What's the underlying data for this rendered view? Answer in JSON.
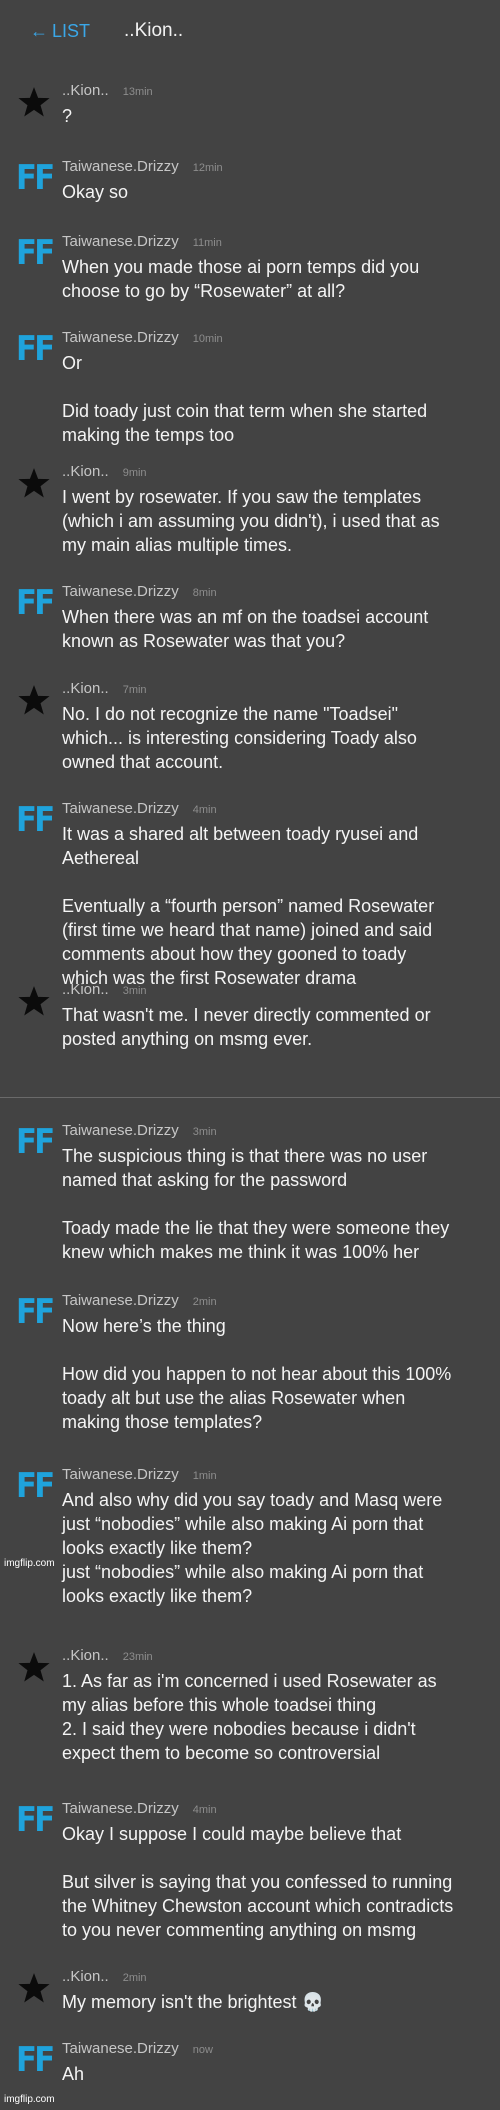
{
  "header": {
    "back_arrow": "←",
    "back_label": "LIST",
    "title": "..Kion.."
  },
  "messages": [
    {
      "avatar": "star",
      "user": "..Kion..",
      "time": "13min",
      "paragraphs": [
        "?"
      ]
    },
    {
      "avatar": "ff",
      "user": "Taiwanese.Drizzy",
      "time": "12min",
      "paragraphs": [
        "Okay so"
      ]
    },
    {
      "avatar": "ff",
      "user": "Taiwanese.Drizzy",
      "time": "11min",
      "paragraphs": [
        "When you made those ai porn temps did you\nchoose to go by “Rosewater” at all?"
      ]
    },
    {
      "avatar": "ff",
      "user": "Taiwanese.Drizzy",
      "time": "10min",
      "paragraphs": [
        "Or",
        "Did toady just coin that term when she started\nmaking the temps too"
      ]
    },
    {
      "avatar": "star",
      "user": "..Kion..",
      "time": "9min",
      "paragraphs": [
        "I went by rosewater. If you saw the templates\n(which i am assuming you didn't), i used that as\nmy main alias multiple times."
      ]
    },
    {
      "avatar": "ff",
      "user": "Taiwanese.Drizzy",
      "time": "8min",
      "paragraphs": [
        "When there was an mf on the toadsei account\nknown as Rosewater was that you?"
      ]
    },
    {
      "avatar": "star",
      "user": "..Kion..",
      "time": "7min",
      "paragraphs": [
        "No. I do not recognize the name \"Toadsei\"\nwhich... is interesting considering Toady also\nowned that account."
      ]
    },
    {
      "avatar": "ff",
      "user": "Taiwanese.Drizzy",
      "time": "4min",
      "paragraphs": [
        "It was a shared alt between toady ryusei and\nAethereal",
        "Eventually a “fourth person” named Rosewater\n(first time we heard that name) joined and said\ncomments about how they gooned to toady\nwhich was the first Rosewater drama"
      ]
    },
    {
      "avatar": "star",
      "user": "..Kion..",
      "time": "3min",
      "paragraphs": [
        "That wasn't me. I never directly commented or\nposted anything on msmg ever."
      ]
    },
    {
      "avatar": "ff",
      "user": "Taiwanese.Drizzy",
      "time": "3min",
      "paragraphs": [
        "The suspicious thing is that there was no user\nnamed that asking for the password",
        "Toady made the lie that they were someone they\nknew which makes me think it was 100% her"
      ]
    },
    {
      "avatar": "ff",
      "user": "Taiwanese.Drizzy",
      "time": "2min",
      "paragraphs": [
        "Now here’s the thing",
        "How did you happen to not hear about this 100%\ntoady alt but use the alias Rosewater when\nmaking those templates?"
      ]
    },
    {
      "avatar": "ff",
      "user": "Taiwanese.Drizzy",
      "time": "1min",
      "paragraphs": [
        "And also why did you say toady and Masq were\njust “nobodies” while also making Ai porn that\nlooks exactly like them?\njust “nobodies” while also making Ai porn that\nlooks exactly like them?"
      ]
    },
    {
      "avatar": "star",
      "user": "..Kion..",
      "time": "23min",
      "paragraphs": [
        "1. As far as i'm concerned i used Rosewater as\nmy alias before this whole toadsei thing\n2. I said they were nobodies because i didn't\nexpect them to become so controversial"
      ]
    },
    {
      "avatar": "ff",
      "user": "Taiwanese.Drizzy",
      "time": "4min",
      "paragraphs": [
        "Okay I suppose I could maybe believe that",
        "But silver is saying that you confessed to running\nthe Whitney Chewston account which contradicts\nto you never commenting anything on msmg"
      ]
    },
    {
      "avatar": "star",
      "user": "..Kion..",
      "time": "2min",
      "paragraphs": [
        "My memory isn't the brightest 💀"
      ]
    },
    {
      "avatar": "ff",
      "user": "Taiwanese.Drizzy",
      "time": "now",
      "paragraphs": [
        "Ah"
      ]
    }
  ],
  "ff_logo_text": "FF",
  "watermarks": [
    "imgflip.com",
    "imgflip.com"
  ],
  "colors": {
    "background": "#434343",
    "accent": "#3aa7e8",
    "ff_logo": "#1fa3dc"
  }
}
